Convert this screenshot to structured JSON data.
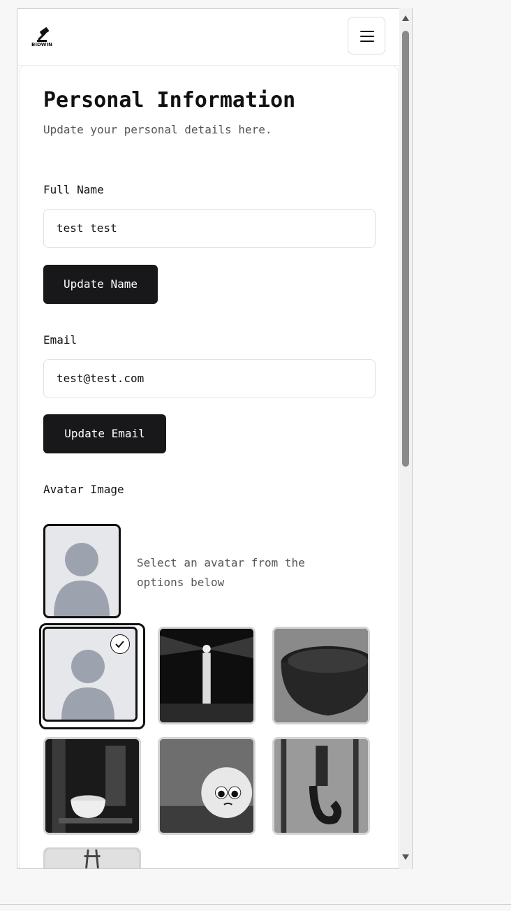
{
  "header": {
    "logo_text": "BIDWIN",
    "menu_icon": "hamburger-menu-icon"
  },
  "page": {
    "title": "Personal Information",
    "subtitle": "Update your personal details here."
  },
  "name_section": {
    "label": "Full Name",
    "value": "test test",
    "button": "Update Name"
  },
  "email_section": {
    "label": "Email",
    "value": "test@test.com",
    "button": "Update Email"
  },
  "avatar_section": {
    "label": "Avatar Image",
    "hint": "Select an avatar from the options below",
    "options": [
      {
        "name": "default-avatar",
        "selected": true
      },
      {
        "name": "lighthouse-at-night",
        "selected": false
      },
      {
        "name": "dark-bowl-closeup",
        "selected": false
      },
      {
        "name": "espresso-machine-cup",
        "selected": false
      },
      {
        "name": "worried-face-ball",
        "selected": false
      },
      {
        "name": "crane-hook-chains",
        "selected": false
      },
      {
        "name": "power-line-tower",
        "selected": false
      }
    ]
  },
  "colors": {
    "button_bg": "#18181b",
    "avatar_bg": "#e5e7eb",
    "avatar_figure": "#9ca3af"
  }
}
